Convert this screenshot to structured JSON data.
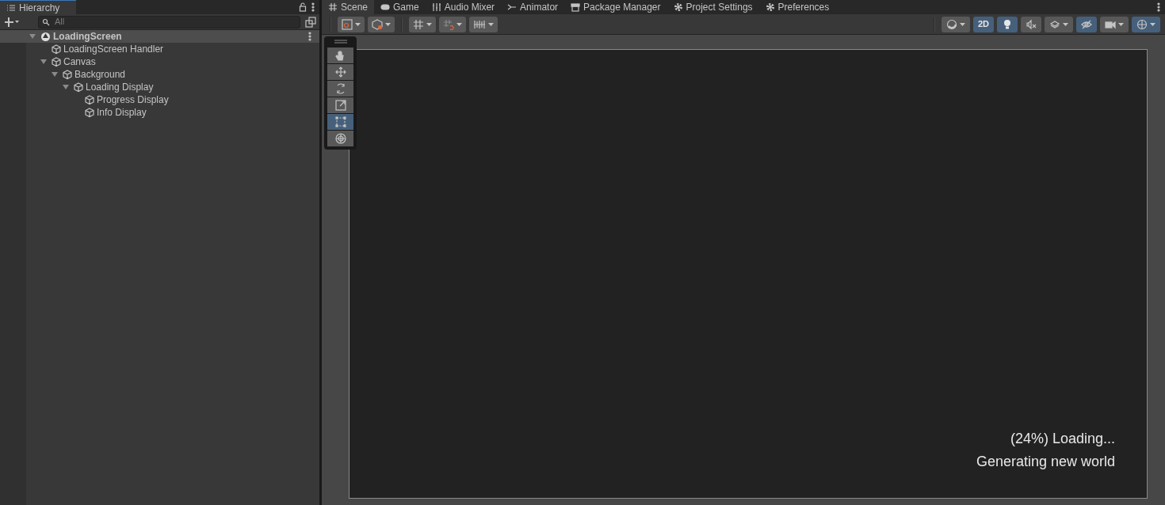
{
  "hierarchy": {
    "title": "Hierarchy",
    "search": {
      "placeholder": "All"
    },
    "tree": [
      {
        "label": "LoadingScreen",
        "kind": "scene",
        "expanded": true,
        "selected": true,
        "children": [
          {
            "label": "LoadingScreen Handler",
            "kind": "object",
            "selected": false
          },
          {
            "label": "Canvas",
            "kind": "object",
            "expanded": true,
            "selected": false,
            "children": [
              {
                "label": "Background",
                "kind": "object",
                "expanded": true,
                "selected": false,
                "children": [
                  {
                    "label": "Loading Display",
                    "kind": "object",
                    "expanded": true,
                    "selected": false,
                    "children": [
                      {
                        "label": "Progress Display",
                        "kind": "object",
                        "selected": false
                      },
                      {
                        "label": "Info Display",
                        "kind": "object",
                        "selected": false
                      }
                    ]
                  }
                ]
              }
            ]
          }
        ]
      }
    ]
  },
  "tabs": [
    {
      "label": "Scene",
      "kind": "grid",
      "selected": true
    },
    {
      "label": "Game",
      "kind": "gamepad",
      "selected": false
    },
    {
      "label": "Audio Mixer",
      "kind": "mixer",
      "selected": false
    },
    {
      "label": "Animator",
      "kind": "animator",
      "selected": false
    },
    {
      "label": "Package Manager",
      "kind": "package",
      "selected": false
    },
    {
      "label": "Project Settings",
      "kind": "gear",
      "selected": false
    },
    {
      "label": "Preferences",
      "kind": "gear",
      "selected": false
    }
  ],
  "view_toggles": [
    {
      "kind": "shading",
      "on": false
    },
    {
      "label": "2D",
      "kind": "text",
      "on": true
    },
    {
      "kind": "light",
      "on": true
    },
    {
      "kind": "audio",
      "on": false
    },
    {
      "kind": "effects",
      "on": false
    },
    {
      "kind": "visibility",
      "on": true
    },
    {
      "kind": "camera",
      "on": false
    },
    {
      "kind": "gizmos",
      "on": true
    }
  ],
  "tools": [
    {
      "kind": "hand",
      "selected": false
    },
    {
      "kind": "move",
      "selected": false
    },
    {
      "kind": "rotate",
      "selected": false
    },
    {
      "kind": "scale",
      "selected": false
    },
    {
      "kind": "rect",
      "selected": true
    },
    {
      "kind": "transform",
      "selected": false
    }
  ],
  "viewport": {
    "lines": [
      "(24%) Loading...",
      "Generating new world"
    ]
  }
}
